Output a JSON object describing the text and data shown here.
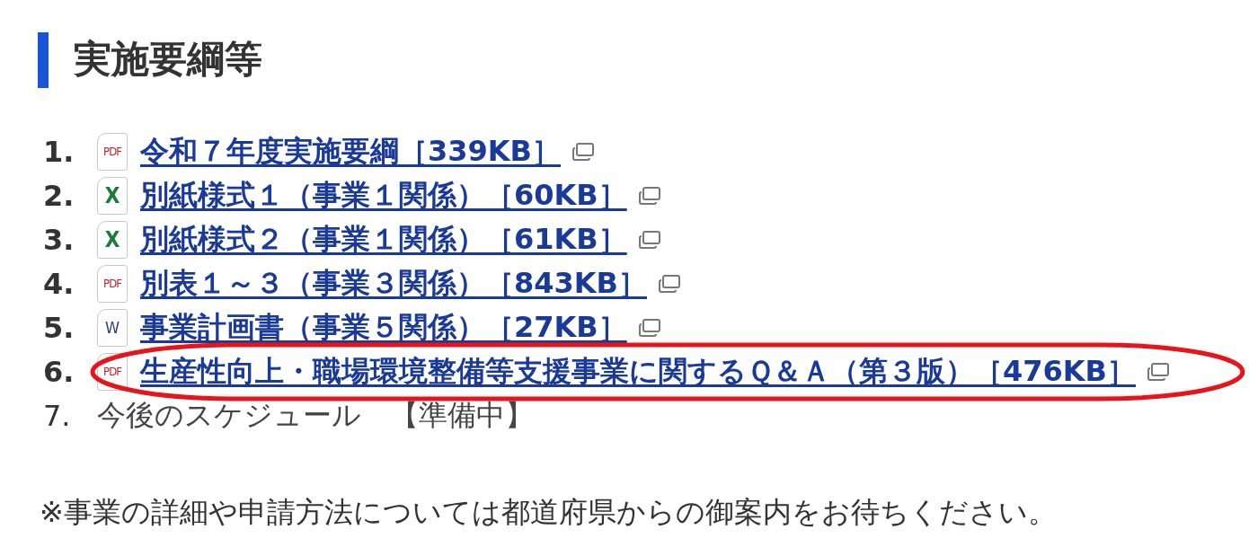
{
  "heading": "実施要綱等",
  "items": [
    {
      "kind": "pdf_link",
      "number": "1.",
      "icon_label": "PDF",
      "label": "令和７年度実施要綱［339KB］",
      "circled": false
    },
    {
      "kind": "excel_link",
      "number": "2.",
      "icon_label": "X",
      "label": "別紙様式１（事業１関係）［60KB］",
      "circled": false
    },
    {
      "kind": "excel_link",
      "number": "3.",
      "icon_label": "X",
      "label": "別紙様式２（事業１関係）［61KB］",
      "circled": false
    },
    {
      "kind": "pdf_link",
      "number": "4.",
      "icon_label": "PDF",
      "label": "別表１～３（事業３関係）［843KB］",
      "circled": false
    },
    {
      "kind": "word_link",
      "number": "5.",
      "icon_label": "W",
      "label": "事業計画書（事業５関係）［27KB］",
      "circled": false
    },
    {
      "kind": "pdf_link",
      "number": "6.",
      "icon_label": "PDF",
      "label": "生産性向上・職場環境整備等支援事業に関するＱ＆Ａ（第３版）［476KB］",
      "circled": true
    },
    {
      "kind": "text",
      "number": "7.",
      "label": "今後のスケジュール　【準備中】",
      "circled": false
    }
  ],
  "annotation": {
    "color": "#e8141b"
  },
  "note": "※事業の詳細や申請方法については都道府県からの御案内をお待ちください。"
}
